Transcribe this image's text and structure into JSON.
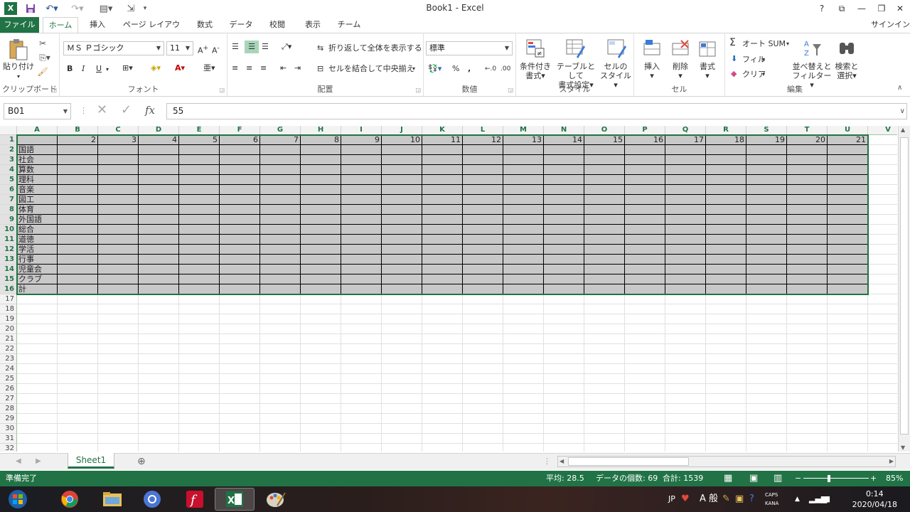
{
  "window": {
    "title": "Book1 - Excel",
    "help": "?",
    "signin": "サインイン"
  },
  "tabs": [
    {
      "label": "ファイル"
    },
    {
      "label": "ホーム"
    },
    {
      "label": "挿入"
    },
    {
      "label": "ページ レイアウト"
    },
    {
      "label": "数式"
    },
    {
      "label": "データ"
    },
    {
      "label": "校閲"
    },
    {
      "label": "表示"
    },
    {
      "label": "チーム"
    }
  ],
  "ribbon": {
    "clipboard": {
      "label": "クリップボード",
      "paste": "貼り付け"
    },
    "font": {
      "label": "フォント",
      "name": "ＭＳ Ｐゴシック",
      "size": "11",
      "bold": "B",
      "italic": "I",
      "underline": "U"
    },
    "alignment": {
      "label": "配置",
      "wrap": "折り返して全体を表示する",
      "merge": "セルを結合して中央揃え"
    },
    "number": {
      "label": "数値",
      "format": "標準",
      "percent": "%",
      "comma": ","
    },
    "styles": {
      "label": "スタイル",
      "conditional_line1": "条件付き",
      "conditional_line2": "書式",
      "table_line1": "テーブルとして",
      "table_line2": "書式設定",
      "cellstyle_line1": "セルの",
      "cellstyle_line2": "スタイル"
    },
    "cells": {
      "label": "セル",
      "insert": "挿入",
      "delete": "削除",
      "format": "書式"
    },
    "editing": {
      "label": "編集",
      "autosum": "オート SUM",
      "fill": "フィル",
      "clear": "クリア",
      "sort_line1": "並べ替えと",
      "sort_line2": "フィルター",
      "find_line1": "検索と",
      "find_line2": "選択"
    }
  },
  "formula_bar": {
    "name_box": "B01",
    "fx": "fx",
    "value": "55"
  },
  "grid": {
    "columns": [
      "A",
      "B",
      "C",
      "D",
      "E",
      "F",
      "G",
      "H",
      "I",
      "J",
      "K",
      "L",
      "M",
      "N",
      "O",
      "P",
      "Q",
      "R",
      "S",
      "T",
      "U",
      "V"
    ],
    "row1_values": [
      "2",
      "3",
      "4",
      "5",
      "6",
      "7",
      "8",
      "9",
      "10",
      "11",
      "12",
      "13",
      "14",
      "15",
      "16",
      "17",
      "18",
      "19",
      "20",
      "21"
    ],
    "subjects": [
      "国語",
      "社会",
      "算数",
      "理科",
      "音楽",
      "図工",
      "体育",
      "外国語",
      "総合",
      "道徳",
      "学活",
      "行事",
      "児童会",
      "クラブ",
      "計"
    ],
    "row_numbers": [
      "1",
      "2",
      "3",
      "4",
      "5",
      "6",
      "7",
      "8",
      "9",
      "10",
      "11",
      "12",
      "13",
      "14",
      "15",
      "16",
      "17",
      "18",
      "19",
      "20",
      "21",
      "22",
      "23",
      "24",
      "25",
      "26",
      "27",
      "28",
      "29",
      "30",
      "31",
      "32"
    ]
  },
  "sheets": {
    "active": "Sheet1"
  },
  "status": {
    "ready": "準備完了",
    "average": "平均: 28.5",
    "count": "データの個数: 69",
    "sum": "合計: 1539",
    "zoom": "85%"
  },
  "taskbar": {
    "ime_lang": "JP",
    "ime_mode": "A 般",
    "caps": "CAPS",
    "kana": "KANA",
    "time": "0:14",
    "date": "2020/04/18"
  },
  "colors": {
    "excel_green": "#217346",
    "selection_fill": "#c8c8c8"
  }
}
